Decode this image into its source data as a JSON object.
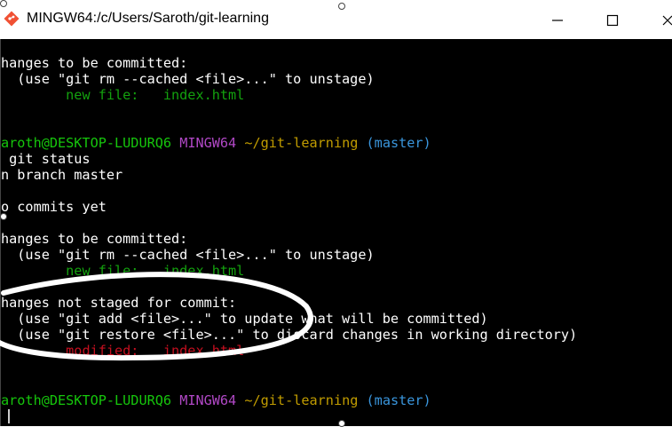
{
  "window": {
    "title": "MINGW64:/c/Users/Saroth/git-learning",
    "icon": "git-bash-icon",
    "controls": {
      "minimize": "—",
      "maximize": "☐",
      "close": "✕"
    }
  },
  "terminal": {
    "lines": [
      {
        "segments": [
          "hanges to be committed:"
        ]
      },
      {
        "segments": [
          "  (use \"git rm --cached <file>...\" to unstage)"
        ]
      },
      {
        "segments": [
          "        ",
          "new file:   index.html"
        ]
      },
      {
        "segments": [
          ""
        ]
      },
      {
        "segments": [
          "aroth@DESKTOP-LUDURQ6",
          " ",
          "MINGW64",
          " ",
          "~/git-learning",
          " ",
          "(master)"
        ]
      },
      {
        "segments": [
          " git status"
        ]
      },
      {
        "segments": [
          "n branch master"
        ]
      },
      {
        "segments": [
          "o commits yet"
        ]
      },
      {
        "segments": [
          "hanges to be committed:"
        ]
      },
      {
        "segments": [
          "  (use \"git rm --cached <file>...\" to unstage)"
        ]
      },
      {
        "segments": [
          "        ",
          "new file:   index.html"
        ]
      },
      {
        "segments": [
          "hanges not staged for commit:"
        ]
      },
      {
        "segments": [
          "  (use \"git add <file>...\" to update what will be committed)"
        ]
      },
      {
        "segments": [
          "  (use \"git restore <file>...\" to discard changes in working directory)"
        ]
      },
      {
        "segments": [
          "        ",
          "modified:   index.html"
        ]
      },
      {
        "segments": [
          "aroth@DESKTOP-LUDURQ6",
          " ",
          "MINGW64",
          " ",
          "~/git-learning",
          " ",
          "(master)"
        ]
      }
    ]
  },
  "colors": {
    "background": "#000000",
    "text": "#ffffff",
    "user_host": "#16c60c",
    "shell": "#b148c6",
    "path": "#c19c00",
    "branch": "#3a96dd",
    "staged_file": "#13a10e",
    "modified_file": "#c50f1f",
    "annotation": "#ffffff"
  }
}
